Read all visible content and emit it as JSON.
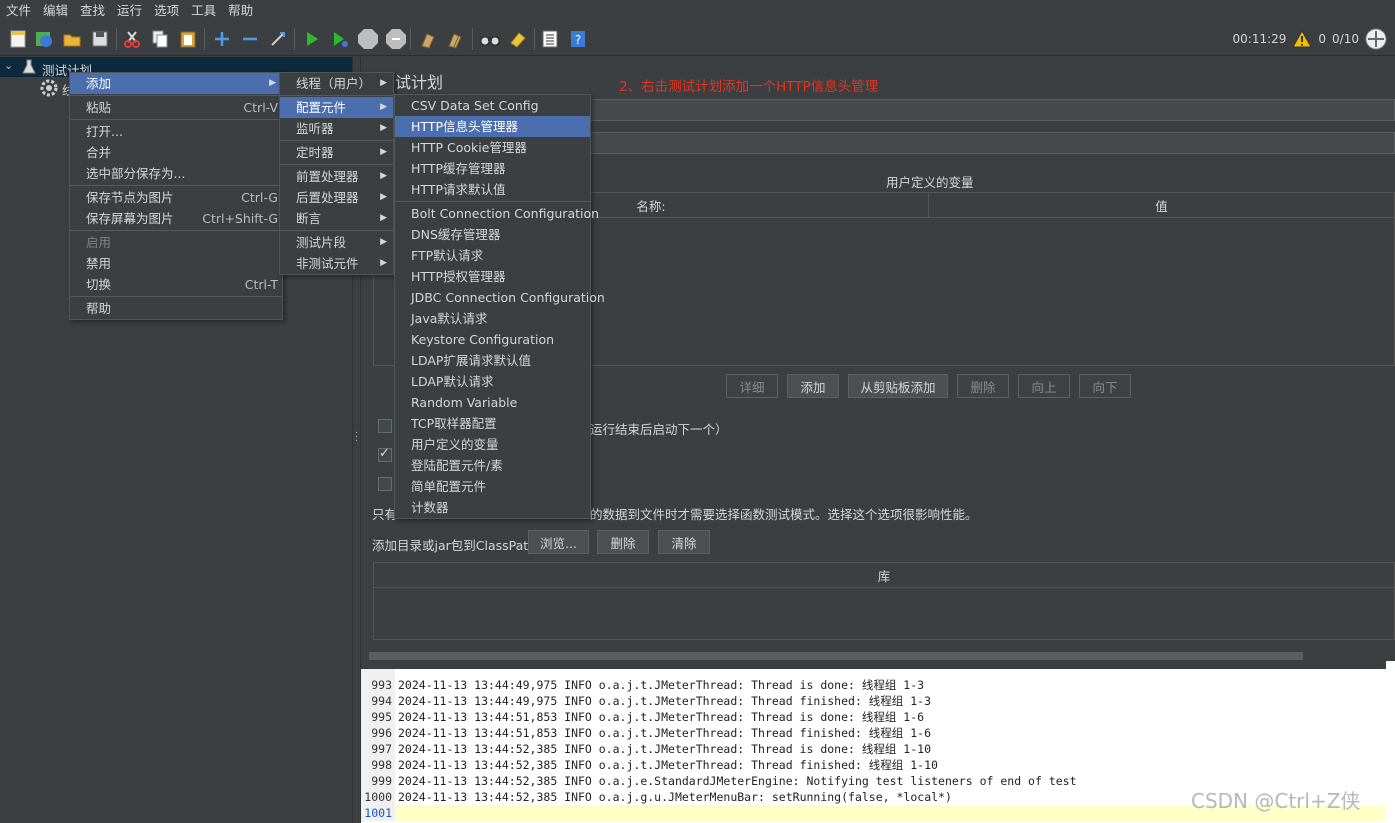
{
  "menubar": {
    "items": [
      "文件",
      "编辑",
      "查找",
      "运行",
      "选项",
      "工具",
      "帮助"
    ]
  },
  "toolbar": {
    "timer": "00:11:29",
    "warn_count": "0",
    "threads": "0/10"
  },
  "tree": {
    "root_label": "测试计划",
    "child_label": "线"
  },
  "main": {
    "title": "试计划",
    "annotation": "2、右击测试计划添加一个HTTP信息头管理",
    "udv_title": "用户定义的变量",
    "col_name": "名称:",
    "col_value": "值",
    "buttons": {
      "detail": "详细",
      "add": "添加",
      "paste": "从剪贴板添加",
      "delete": "删除",
      "up": "向上",
      "down": "向下"
    },
    "cb1_text": "运行结束后启动下一个）",
    "info_prefix": "只有",
    "info_text": "的数据到文件时才需要选择函数测试模式。选择这个选项很影响性能。",
    "classpath_label": "添加目录或jar包到ClassPath",
    "browse": "浏览...",
    "cp_delete": "删除",
    "cp_clear": "清除",
    "lib_col": "库"
  },
  "menu1": [
    {
      "label": "添加",
      "accel": "",
      "arrow": true,
      "selected": true
    },
    {
      "sep": true
    },
    {
      "label": "粘贴",
      "accel": "Ctrl-V"
    },
    {
      "sep": true
    },
    {
      "label": "打开...",
      "accel": ""
    },
    {
      "label": "合并",
      "accel": ""
    },
    {
      "label": "选中部分保存为...",
      "accel": ""
    },
    {
      "sep": true
    },
    {
      "label": "保存节点为图片",
      "accel": "Ctrl-G"
    },
    {
      "label": "保存屏幕为图片",
      "accel": "Ctrl+Shift-G"
    },
    {
      "sep": true
    },
    {
      "label": "启用",
      "accel": "",
      "disabled": true
    },
    {
      "label": "禁用",
      "accel": ""
    },
    {
      "label": "切换",
      "accel": "Ctrl-T"
    },
    {
      "sep": true
    },
    {
      "label": "帮助",
      "accel": ""
    }
  ],
  "menu2": [
    {
      "label": "线程（用户）",
      "arrow": true
    },
    {
      "label": "配置元件",
      "arrow": true,
      "selected": true
    },
    {
      "label": "监听器",
      "arrow": true
    },
    {
      "label": "定时器",
      "arrow": true
    },
    {
      "label": "前置处理器",
      "arrow": true
    },
    {
      "label": "后置处理器",
      "arrow": true
    },
    {
      "label": "断言",
      "arrow": true
    },
    {
      "label": "测试片段",
      "arrow": true
    },
    {
      "label": "非测试元件",
      "arrow": true
    }
  ],
  "menu3": [
    {
      "label": "CSV Data Set Config"
    },
    {
      "label": "HTTP信息头管理器",
      "selected": true
    },
    {
      "label": "HTTP Cookie管理器"
    },
    {
      "label": "HTTP缓存管理器"
    },
    {
      "label": "HTTP请求默认值"
    },
    {
      "sep": true
    },
    {
      "label": "Bolt Connection Configuration"
    },
    {
      "label": "DNS缓存管理器"
    },
    {
      "label": "FTP默认请求"
    },
    {
      "label": "HTTP授权管理器"
    },
    {
      "label": "JDBC Connection Configuration"
    },
    {
      "label": "Java默认请求"
    },
    {
      "label": "Keystore Configuration"
    },
    {
      "label": "LDAP扩展请求默认值"
    },
    {
      "label": "LDAP默认请求"
    },
    {
      "label": "Random Variable"
    },
    {
      "label": "TCP取样器配置"
    },
    {
      "label": "用户定义的变量"
    },
    {
      "label": "登陆配置元件/素"
    },
    {
      "label": "简单配置元件"
    },
    {
      "label": "计数器"
    }
  ],
  "log": [
    {
      "no": "993",
      "text": "2024-11-13 13:44:49,975 INFO o.a.j.t.JMeterThread: Thread is done: 线程组 1-3"
    },
    {
      "no": "994",
      "text": "2024-11-13 13:44:49,975 INFO o.a.j.t.JMeterThread: Thread finished: 线程组 1-3"
    },
    {
      "no": "995",
      "text": "2024-11-13 13:44:51,853 INFO o.a.j.t.JMeterThread: Thread is done: 线程组 1-6"
    },
    {
      "no": "996",
      "text": "2024-11-13 13:44:51,853 INFO o.a.j.t.JMeterThread: Thread finished: 线程组 1-6"
    },
    {
      "no": "997",
      "text": "2024-11-13 13:44:52,385 INFO o.a.j.t.JMeterThread: Thread is done: 线程组 1-10"
    },
    {
      "no": "998",
      "text": "2024-11-13 13:44:52,385 INFO o.a.j.t.JMeterThread: Thread finished: 线程组 1-10"
    },
    {
      "no": "999",
      "text": "2024-11-13 13:44:52,385 INFO o.a.j.e.StandardJMeterEngine: Notifying test listeners of end of test"
    },
    {
      "no": "1000",
      "text": "2024-11-13 13:44:52,385 INFO o.a.j.g.u.JMeterMenuBar: setRunning(false, *local*)"
    },
    {
      "no": "1001",
      "text": ""
    }
  ],
  "watermark": "CSDN @Ctrl+Z侠"
}
